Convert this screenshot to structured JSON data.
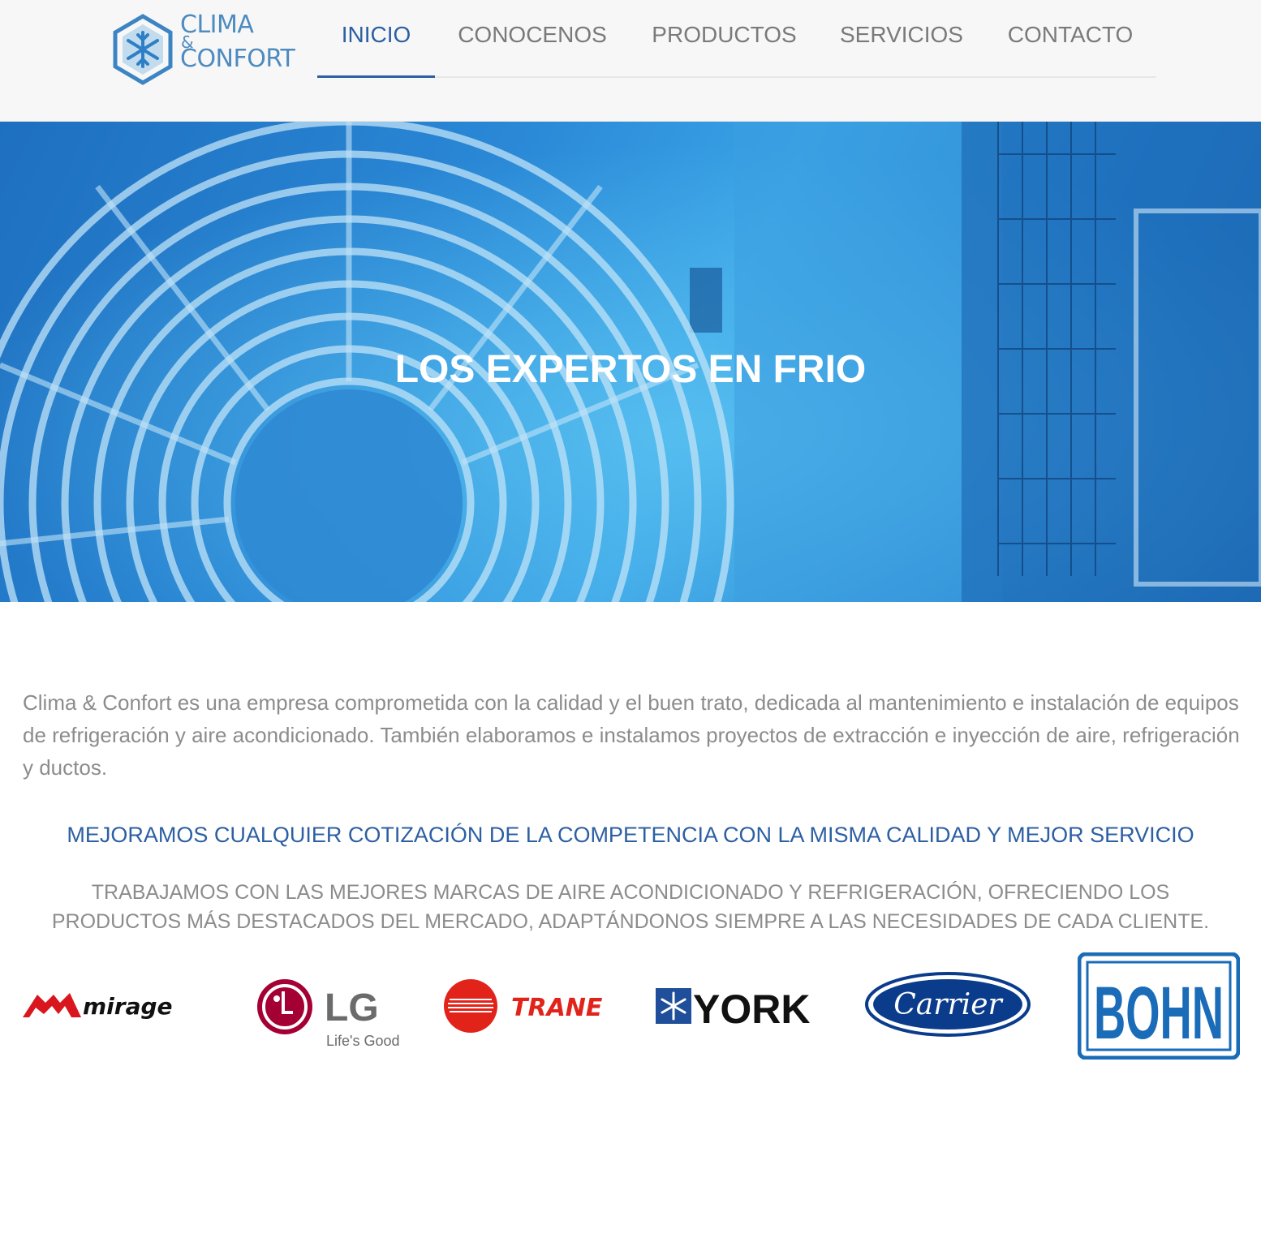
{
  "header": {
    "logo": {
      "line1": "CLIMA",
      "amp": "&",
      "line2": "CONFORT",
      "icon": "snowflake-hexagon-icon"
    },
    "nav": [
      {
        "label": "INICIO",
        "active": true
      },
      {
        "label": "CONOCENOS",
        "active": false
      },
      {
        "label": "PRODUCTOS",
        "active": false
      },
      {
        "label": "SERVICIOS",
        "active": false
      },
      {
        "label": "CONTACTO",
        "active": false
      }
    ]
  },
  "hero": {
    "title": "LOS EXPERTOS EN FRIO",
    "background": "air-conditioner-fan-grille-photo"
  },
  "intro": {
    "text": "Clima & Confort es una empresa comprometida con la calidad y el buen trato, dedicada al mantenimiento e instalación de equipos de refrigeración y aire acondicionado. También elaboramos e instalamos proyectos de extracción e inyección de aire, refrigeración y ductos."
  },
  "promo": {
    "text": "MEJORAMOS CUALQUIER COTIZACIÓN DE LA COMPETENCIA CON LA MISMA CALIDAD Y MEJOR SERVICIO"
  },
  "brands": {
    "text": "TRABAJAMOS CON LAS MEJORES MARCAS DE AIRE ACONDICIONADO Y REFRIGERACIÓN, OFRECIENDO LOS PRODUCTOS MÁS DESTACADOS DEL MERCADO, ADAPTÁNDONOS SIEMPRE A LAS NECESIDADES DE CADA CLIENTE.",
    "logos": [
      {
        "name": "mirage",
        "wordmark": "mirage"
      },
      {
        "name": "lg",
        "wordmark": "LG",
        "tagline": "Life's Good"
      },
      {
        "name": "trane",
        "wordmark": "TRANE"
      },
      {
        "name": "york",
        "wordmark": "YORK"
      },
      {
        "name": "carrier",
        "wordmark": "Carrier"
      },
      {
        "name": "bohn",
        "wordmark": "BOHN"
      }
    ]
  },
  "colors": {
    "accent": "#2c5fa3",
    "logo_blue": "#4d8bc0",
    "nav_text": "#7a7a7a",
    "body_text": "#8c8c8c",
    "hero_blue": "#2a88d6",
    "mirage_red": "#d9161d",
    "lg_magenta": "#a50034",
    "trane_red": "#e2231a",
    "york_blue": "#1f4e9a",
    "carrier_blue": "#0b3c8c",
    "bohn_blue": "#1a6bb8"
  }
}
